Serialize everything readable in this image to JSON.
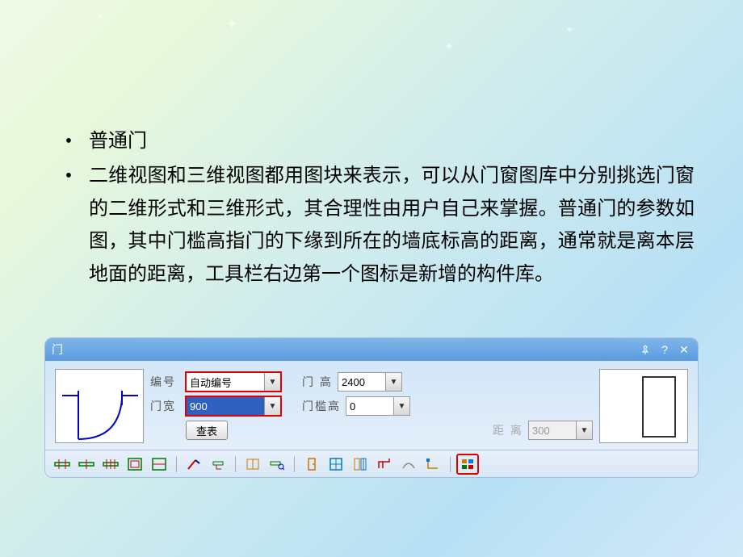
{
  "sparks": [
    "✦",
    "✦",
    "✦",
    "✦"
  ],
  "bullets": {
    "item1": "普通门",
    "item2": "二维视图和三维视图都用图块来表示，可以从门窗图库中分别挑选门窗的二维形式和三维形式，其合理性由用户自己来掌握。普通门的参数如图，其中门槛高指门的下缘到所在的墙底标高的距离，通常就是离本层地面的距离，工具栏右边第一个图标是新增的构件库。"
  },
  "dialog": {
    "title": "门",
    "pin_icon": "📌",
    "help_icon": "?",
    "close_icon": "✕",
    "fields": {
      "number_label": "编号",
      "number_value": "自动编号",
      "height_label": "门  高",
      "height_value": "2400",
      "width_label": "门宽",
      "width_value": "900",
      "sill_label": "门槛高",
      "sill_value": "0",
      "lookup_btn": "查表",
      "distance_label": "距  离",
      "distance_value": "300"
    }
  }
}
